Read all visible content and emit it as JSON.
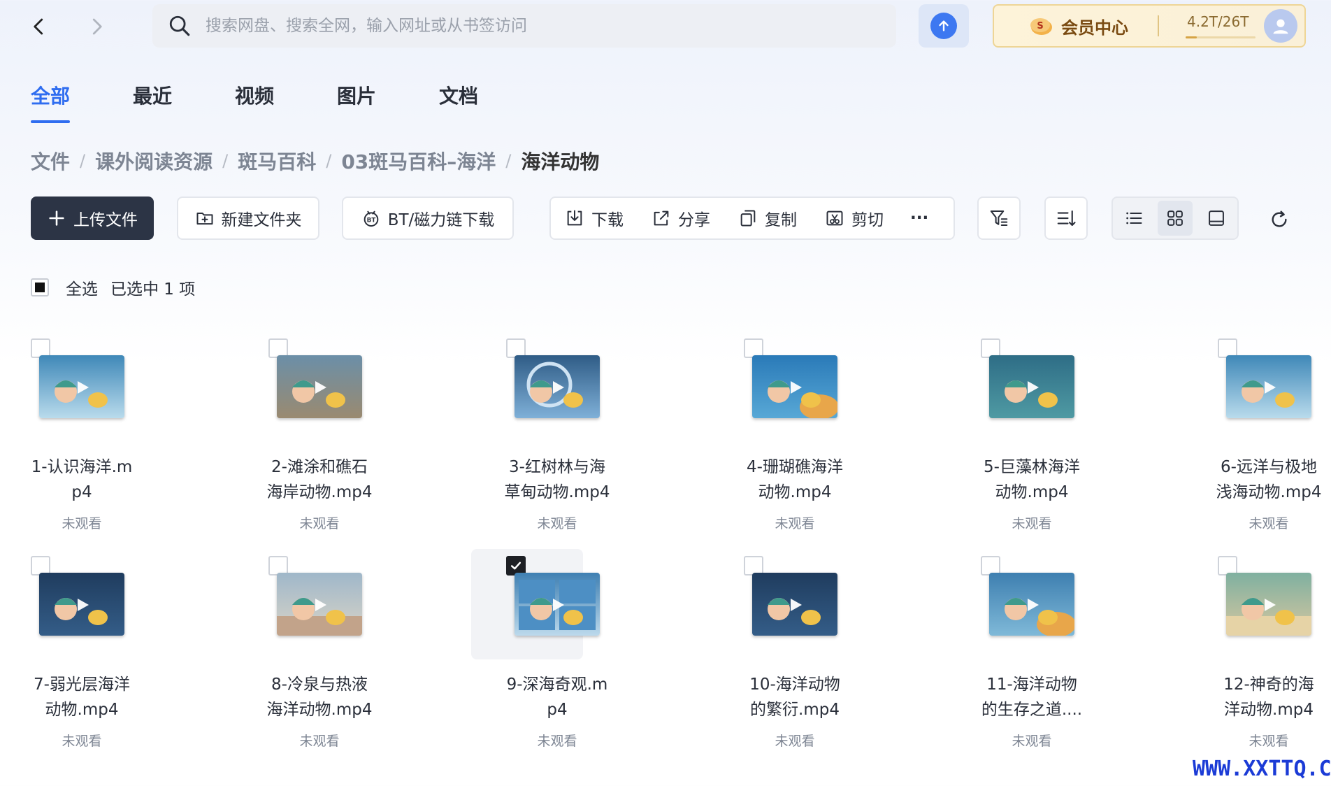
{
  "nav": {
    "back_icon": "chevron-left-icon",
    "forward_icon": "chevron-right-icon"
  },
  "search": {
    "placeholder": "搜索网盘、搜索全网，输入网址或从书签访问",
    "value": ""
  },
  "vip": {
    "label": "会员中心",
    "storage": "4.2T/26T",
    "storage_fraction": 0.16
  },
  "tabs": [
    {
      "label": "全部",
      "active": true
    },
    {
      "label": "最近",
      "active": false
    },
    {
      "label": "视频",
      "active": false
    },
    {
      "label": "图片",
      "active": false
    },
    {
      "label": "文档",
      "active": false
    }
  ],
  "breadcrumb": [
    "文件",
    "课外阅读资源",
    "斑马百科",
    "03斑马百科–海洋",
    "海洋动物"
  ],
  "toolbar": {
    "upload": "上传文件",
    "new_folder": "新建文件夹",
    "bt": "BT/磁力链下载",
    "download": "下载",
    "share": "分享",
    "copy": "复制",
    "cut": "剪切",
    "more": "···"
  },
  "selection": {
    "all_label": "全选",
    "selected_label": "已选中 1 项"
  },
  "files": [
    {
      "name_line1": "1-认识海洋.m",
      "name_line2": "p4",
      "status": "未观看",
      "checked": false,
      "scene": "blue"
    },
    {
      "name_line1": "2-滩涂和礁石",
      "name_line2": "海岸动物.mp4",
      "status": "未观看",
      "checked": false,
      "scene": "rock"
    },
    {
      "name_line1": "3-红树林与海",
      "name_line2": "草甸动物.mp4",
      "status": "未观看",
      "checked": false,
      "scene": "portal"
    },
    {
      "name_line1": "4-珊瑚礁海洋",
      "name_line2": "动物.mp4",
      "status": "未观看",
      "checked": false,
      "scene": "coral"
    },
    {
      "name_line1": "5-巨藻林海洋",
      "name_line2": "动物.mp4",
      "status": "未观看",
      "checked": false,
      "scene": "kelp"
    },
    {
      "name_line1": "6-远洋与极地",
      "name_line2": "浅海动物.mp4",
      "status": "未观看",
      "checked": false,
      "scene": "blue"
    },
    {
      "name_line1": "7-弱光层海洋",
      "name_line2": "动物.mp4",
      "status": "未观看",
      "checked": false,
      "scene": "dark"
    },
    {
      "name_line1": "8-冷泉与热液",
      "name_line2": "海洋动物.mp4",
      "status": "未观看",
      "checked": false,
      "scene": "vent"
    },
    {
      "name_line1": "9-深海奇观.m",
      "name_line2": "p4",
      "status": "未观看",
      "checked": true,
      "scene": "split"
    },
    {
      "name_line1": "10-海洋动物",
      "name_line2": "的繁衍.mp4",
      "status": "未观看",
      "checked": false,
      "scene": "dark"
    },
    {
      "name_line1": "11-海洋动物",
      "name_line2": "的生存之道....",
      "status": "未观看",
      "checked": false,
      "scene": "reef"
    },
    {
      "name_line1": "12-神奇的海",
      "name_line2": "洋动物.mp4",
      "status": "未观看",
      "checked": false,
      "scene": "beach"
    }
  ],
  "watermark": "WWW.XXTTQ.COM",
  "colors": {
    "accent": "#2f6df0",
    "primary_button": "#2c3445",
    "vip_gold": "#7a4b12"
  }
}
